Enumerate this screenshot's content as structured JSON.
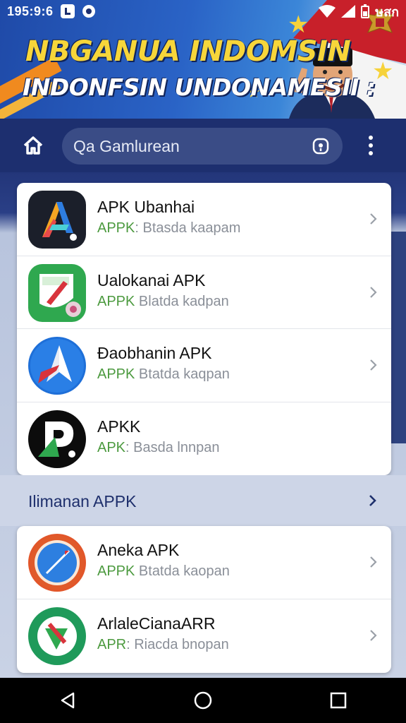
{
  "status_bar": {
    "time": "195:9:6",
    "right_text": "ษสก"
  },
  "banner": {
    "headline_line1": "NBGANUA INDOMSIN",
    "headline_line2": "INDONFSIN UNDONAMESII :"
  },
  "search": {
    "text": "Qa Gamlurean"
  },
  "apps_top": [
    {
      "title": "APK Ubanhai",
      "sub_prefix": "APPK",
      "sub_rest": ": Btasda kaapam",
      "icon": "arrow-a-icon"
    },
    {
      "title": "Ualokanai APK",
      "sub_prefix": "APPK",
      "sub_rest": " Blatda kadpan",
      "icon": "green-clipboard-icon"
    },
    {
      "title": "Đaobhanin APK",
      "sub_prefix": "APPK",
      "sub_rest": " Btatda kaqpan",
      "icon": "blue-compass-icon"
    },
    {
      "title": "APKK",
      "sub_prefix": "APK",
      "sub_rest": ": Basda lnnpan",
      "icon": "black-p-icon"
    }
  ],
  "section": {
    "title": "Ilimanan APPK"
  },
  "apps_bottom": [
    {
      "title": "Aneka APK",
      "sub_prefix": "APPK",
      "sub_rest": " Btatda kaopan",
      "icon": "orange-compass-icon"
    },
    {
      "title": "ArlaleCianaARR",
      "sub_prefix": "APR",
      "sub_rest": ": Riacda bnopan",
      "icon": "green-circle-icon"
    }
  ],
  "colors": {
    "header_bg": "#1d2f6f",
    "search_bg": "#3a4c86",
    "apk_green": "#4c9a3f",
    "headline_yellow": "#f7d63a"
  }
}
